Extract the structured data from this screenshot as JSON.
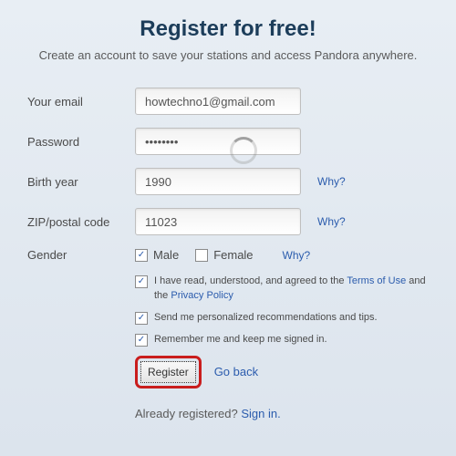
{
  "header": {
    "title": "Register for free!",
    "subtitle": "Create an account to save your stations and access Pandora anywhere."
  },
  "form": {
    "email": {
      "label": "Your email",
      "value": "howtechno1@gmail.com"
    },
    "password": {
      "label": "Password",
      "value": "••••••••"
    },
    "birth_year": {
      "label": "Birth year",
      "value": "1990",
      "why": "Why?"
    },
    "zip": {
      "label": "ZIP/postal code",
      "value": "11023",
      "why": "Why?"
    },
    "gender": {
      "label": "Gender",
      "male": "Male",
      "female": "Female",
      "why": "Why?"
    }
  },
  "agreements": {
    "terms_pre": "I have read, understood, and agreed to the ",
    "terms_link": "Terms of Use",
    "terms_mid": " and the ",
    "privacy_link": "Privacy Policy",
    "recs": "Send me personalized recommendations and tips.",
    "remember": "Remember me and keep me signed in."
  },
  "actions": {
    "register": "Register",
    "go_back": "Go back"
  },
  "footer": {
    "text": "Already registered? ",
    "signin": "Sign in."
  },
  "icons": {
    "check": "✓"
  }
}
